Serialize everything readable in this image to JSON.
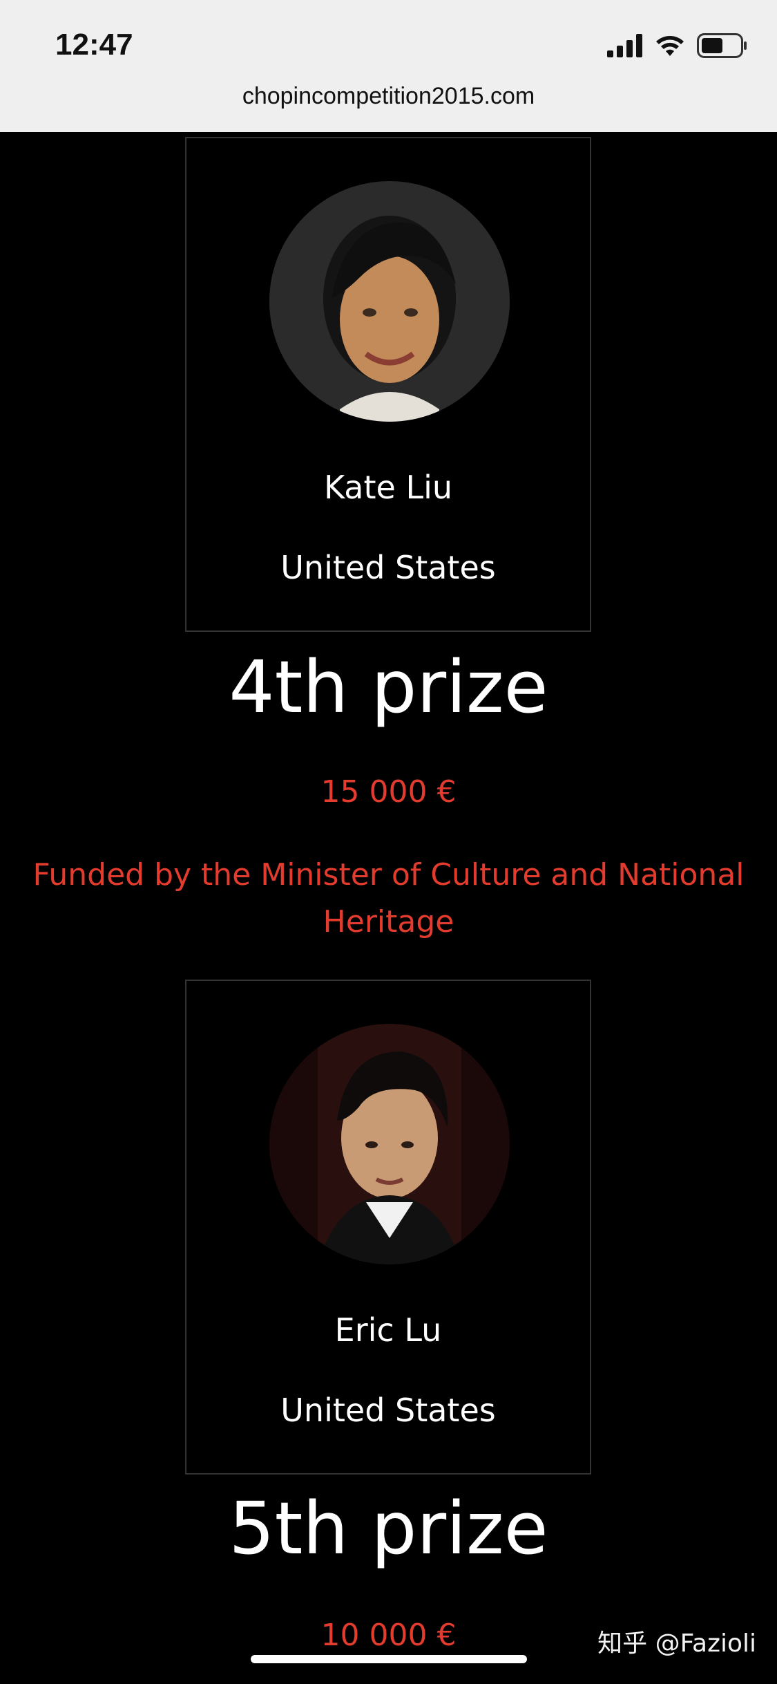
{
  "status_bar": {
    "time": "12:47",
    "icons": [
      "cellular-signal-icon",
      "wifi-icon",
      "battery-icon"
    ],
    "url": "chopincompetition2015.com"
  },
  "laureates": [
    {
      "name": "Kate Liu",
      "country": "United States",
      "prize": "4th prize",
      "amount": "15 000 €",
      "funded_by": "Funded by the Minister of Culture and National Heritage"
    },
    {
      "name": "Eric Lu",
      "country": "United States",
      "prize": "5th prize",
      "amount": "10 000 €"
    }
  ],
  "watermark": "知乎 @Fazioli",
  "colors": {
    "background": "#000000",
    "accent_red": "#e33b2e",
    "text": "#ffffff",
    "status_bar_bg": "#efefef"
  }
}
